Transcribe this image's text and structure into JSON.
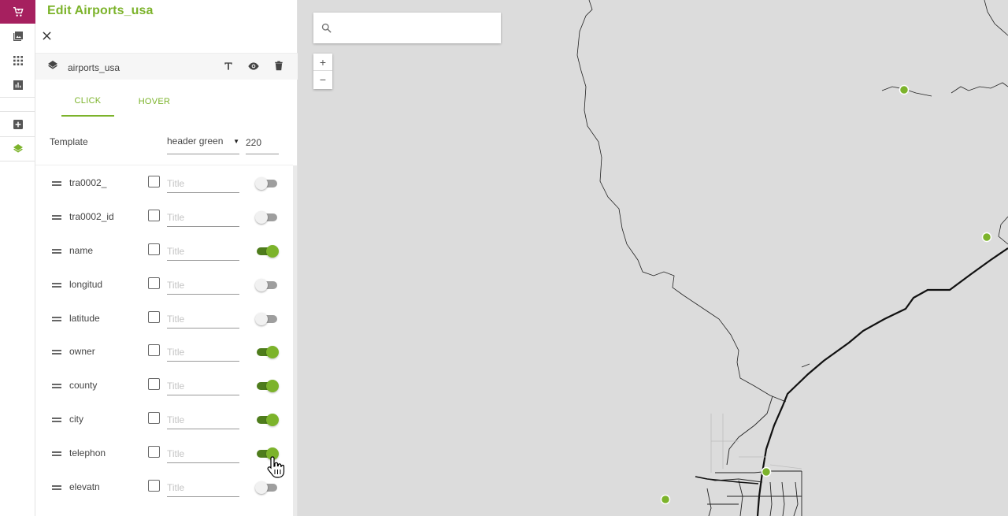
{
  "rail": {
    "items": [
      {
        "icon": "cart-icon",
        "active": true
      },
      {
        "icon": "image-icon"
      },
      {
        "icon": "grid-icon"
      },
      {
        "icon": "bar-chart-icon"
      },
      {
        "icon": "add-box-icon"
      },
      {
        "icon": "layers-icon"
      }
    ],
    "active_color": "#a6205f",
    "layers_color": "#7cb32b"
  },
  "panel": {
    "title": "Edit Airports_usa",
    "layer": {
      "name": "airports_usa",
      "actions": [
        "text-icon",
        "eye-icon",
        "trash-icon"
      ]
    },
    "tabs": [
      {
        "label": "CLICK",
        "active": true
      },
      {
        "label": "HOVER",
        "active": false
      }
    ],
    "template": {
      "label": "Template",
      "selected": "header green",
      "width": "220"
    },
    "title_placeholder": "Title",
    "fields": [
      {
        "name": "tra0002_",
        "checked": false,
        "enabled": false
      },
      {
        "name": "tra0002_id",
        "checked": false,
        "enabled": false
      },
      {
        "name": "name",
        "checked": false,
        "enabled": true
      },
      {
        "name": "longitud",
        "checked": false,
        "enabled": false
      },
      {
        "name": "latitude",
        "checked": false,
        "enabled": false
      },
      {
        "name": "owner",
        "checked": false,
        "enabled": true
      },
      {
        "name": "county",
        "checked": false,
        "enabled": true
      },
      {
        "name": "city",
        "checked": false,
        "enabled": true
      },
      {
        "name": "telephon",
        "checked": false,
        "enabled": true
      },
      {
        "name": "elevatn",
        "checked": false,
        "enabled": false
      }
    ],
    "accent": "#7cb32b"
  },
  "map": {
    "search": {
      "placeholder": "",
      "value": ""
    },
    "zoom_in": "+",
    "zoom_out": "−",
    "background": "#dcdcdc",
    "point_color": "#7cb32b"
  }
}
